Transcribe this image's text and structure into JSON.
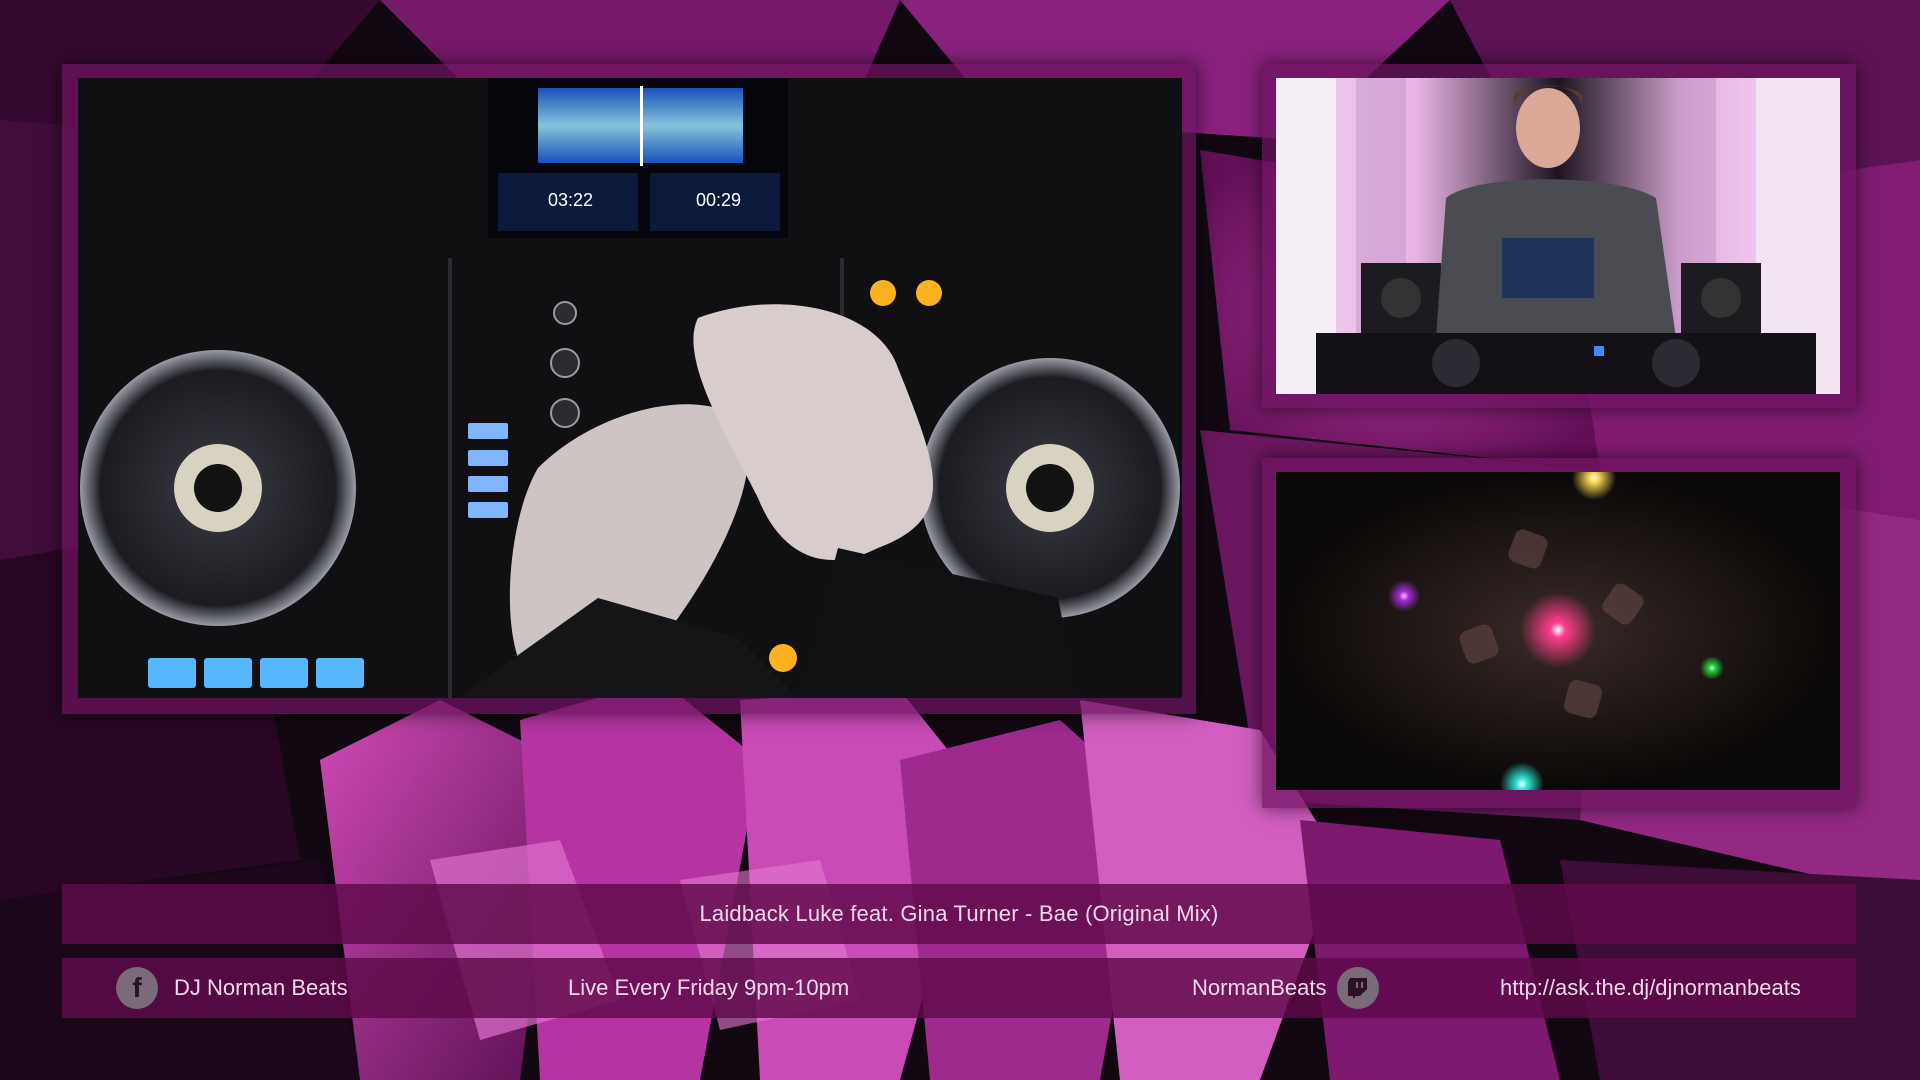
{
  "overlay": {
    "now_playing": "Laidback Luke feat. Gina Turner - Bae (Original Mix)",
    "facebook_name": "DJ Norman Beats",
    "schedule": "Live Every Friday 9pm-10pm",
    "twitch_name": "NormanBeats",
    "ask_url": "http://ask.the.dj/djnormanbeats"
  },
  "deck_display": {
    "left_time": "03:22",
    "right_time": "00:29"
  },
  "icons": {
    "facebook": "facebook-icon",
    "twitch": "twitch-icon"
  },
  "colors": {
    "accent_magenta": "#c0309e",
    "bar_background": "#5f0a4b",
    "text": "#f1d9ec"
  }
}
